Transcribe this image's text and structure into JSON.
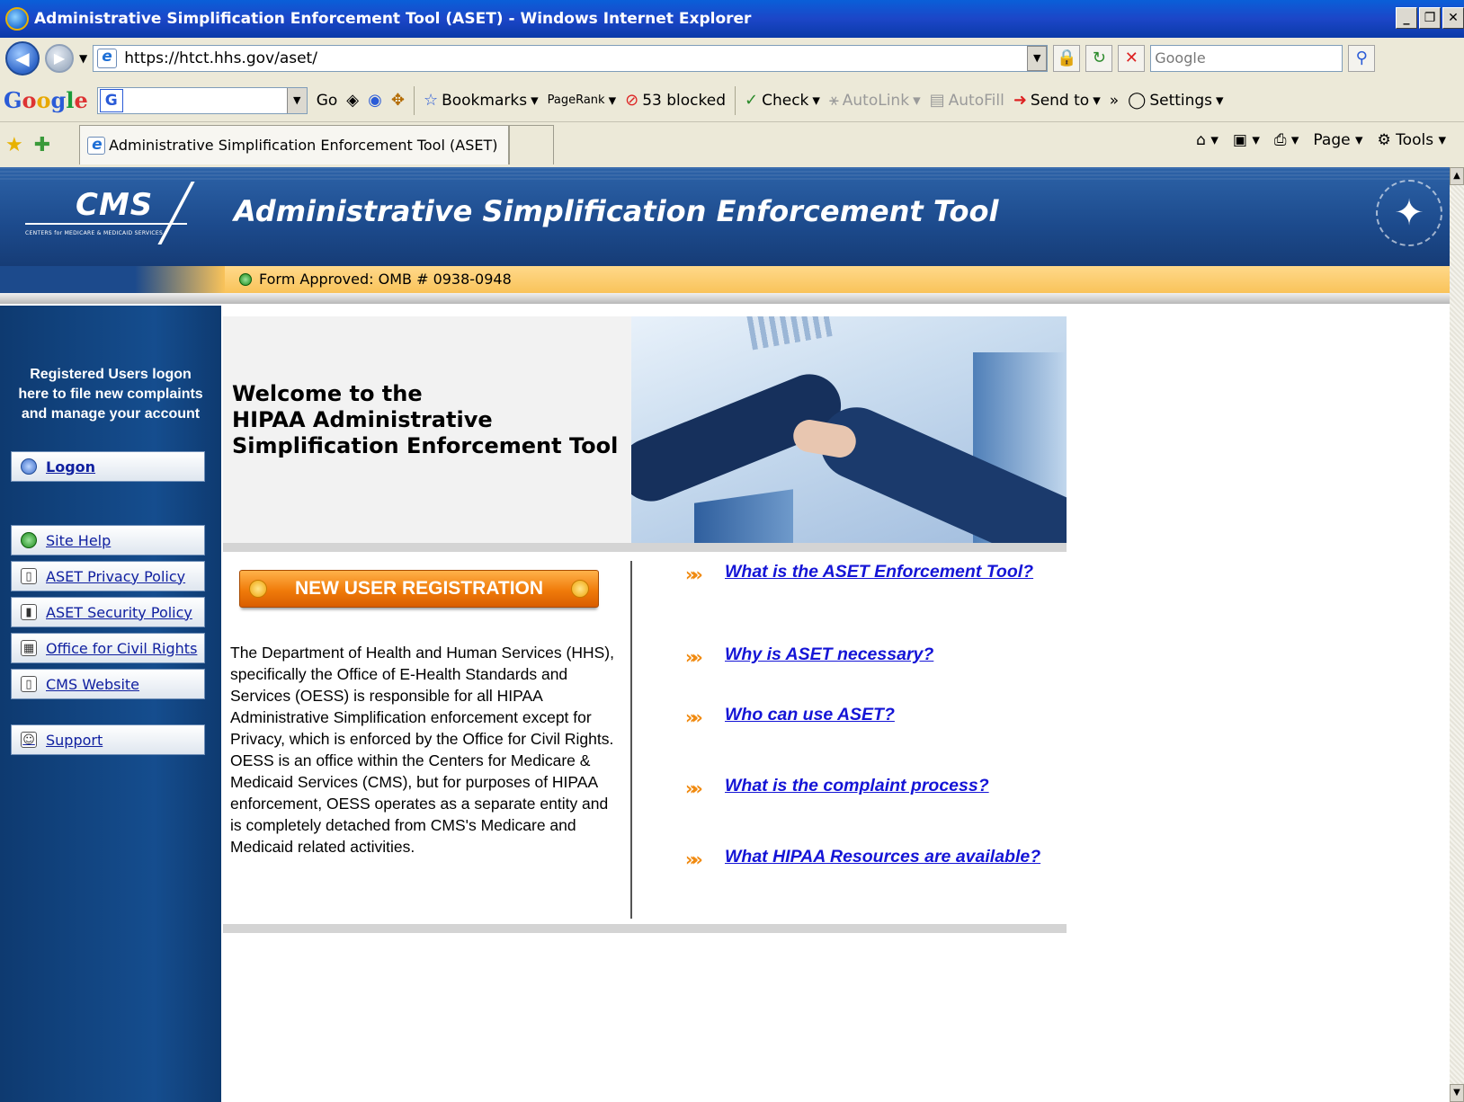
{
  "window": {
    "title": "Administrative Simplification Enforcement Tool (ASET) - Windows Internet Explorer",
    "controls": [
      "_",
      "❐",
      "✕"
    ]
  },
  "address": {
    "url": "https://htct.hhs.gov/aset/",
    "search_placeholder": "Google"
  },
  "googlebar": {
    "go": "Go",
    "bookmarks": "Bookmarks",
    "pagerank": "PageRank",
    "blocked": "53 blocked",
    "check": "Check",
    "autolink": "AutoLink",
    "autofill": "AutoFill",
    "sendto": "Send to",
    "more": "»",
    "settings": "Settings"
  },
  "tabs": {
    "active_title": "Administrative Simplification Enforcement Tool (ASET)"
  },
  "commandbar": {
    "page": "Page",
    "tools": "Tools"
  },
  "banner": {
    "logo_text": "CMS",
    "logo_tagline": "CENTERS for MEDICARE & MEDICAID SERVICES",
    "title": "Administrative Simplification Enforcement Tool",
    "omb": "Form Approved: OMB # 0938-0948"
  },
  "sidebar": {
    "intro_lines": [
      "Registered Users logon",
      "here to file new complaints",
      "and manage your account"
    ],
    "logon": "Logon",
    "links": [
      {
        "label": "Site Help",
        "icon": "help-icon"
      },
      {
        "label": "ASET Privacy Policy",
        "icon": "document-icon"
      },
      {
        "label": "ASET Security Policy",
        "icon": "lock-document-icon"
      },
      {
        "label": "Office for Civil Rights",
        "icon": "building-icon"
      },
      {
        "label": "CMS Website",
        "icon": "document-icon"
      }
    ],
    "support": "Support"
  },
  "welcome": {
    "line1": "Welcome to the",
    "line2": "HIPAA Administrative",
    "line3": "Simplification Enforcement Tool"
  },
  "registration_button": "NEW USER REGISTRATION",
  "description": "The Department of Health and Human Services (HHS), specifically the Office of E-Health Standards and Services (OESS) is responsible for all HIPAA Administrative Simplification enforcement except for Privacy, which is enforced by the Office for Civil Rights. OESS is an office within the Centers for Medicare & Medicaid Services (CMS), but for purposes of HIPAA enforcement, OESS operates as a separate entity and is completely detached from CMS's Medicare and Medicaid related activities.",
  "faq": [
    "What is the ASET Enforcement Tool?",
    "Why is ASET necessary?",
    "Who can use ASET?",
    "What is the complaint process?",
    "What HIPAA Resources are available?"
  ]
}
